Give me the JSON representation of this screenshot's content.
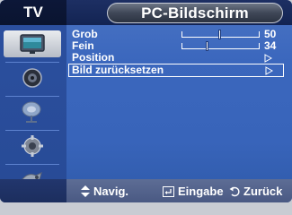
{
  "header": {
    "source_tab": "TV",
    "title": "PC-Bildschirm"
  },
  "sidebar": {
    "items": [
      {
        "name": "picture-menu-icon",
        "active": true
      },
      {
        "name": "sound-menu-icon",
        "active": false
      },
      {
        "name": "channel-menu-icon",
        "active": false
      },
      {
        "name": "setup-menu-icon",
        "active": false
      },
      {
        "name": "input-menu-icon",
        "active": false
      }
    ]
  },
  "menu": {
    "rows": [
      {
        "label": "Grob",
        "value": "50",
        "level": 0.5
      },
      {
        "label": "Fein",
        "value": "34",
        "level": 0.34
      },
      {
        "label": "Position"
      },
      {
        "label": "Bild zurücksetzen",
        "selected": true
      }
    ]
  },
  "footer": {
    "nav_label": "Navig.",
    "enter_label": "Eingabe",
    "back_label": "Zurück",
    "nav_icon": "up-down-arrows-icon",
    "enter_icon": "enter-icon",
    "back_icon": "return-icon"
  },
  "colors": {
    "panel_blue": "#3b67bd",
    "header_dark": "#132453",
    "footer_gray": "#4a5983",
    "text": "#ffffff"
  }
}
